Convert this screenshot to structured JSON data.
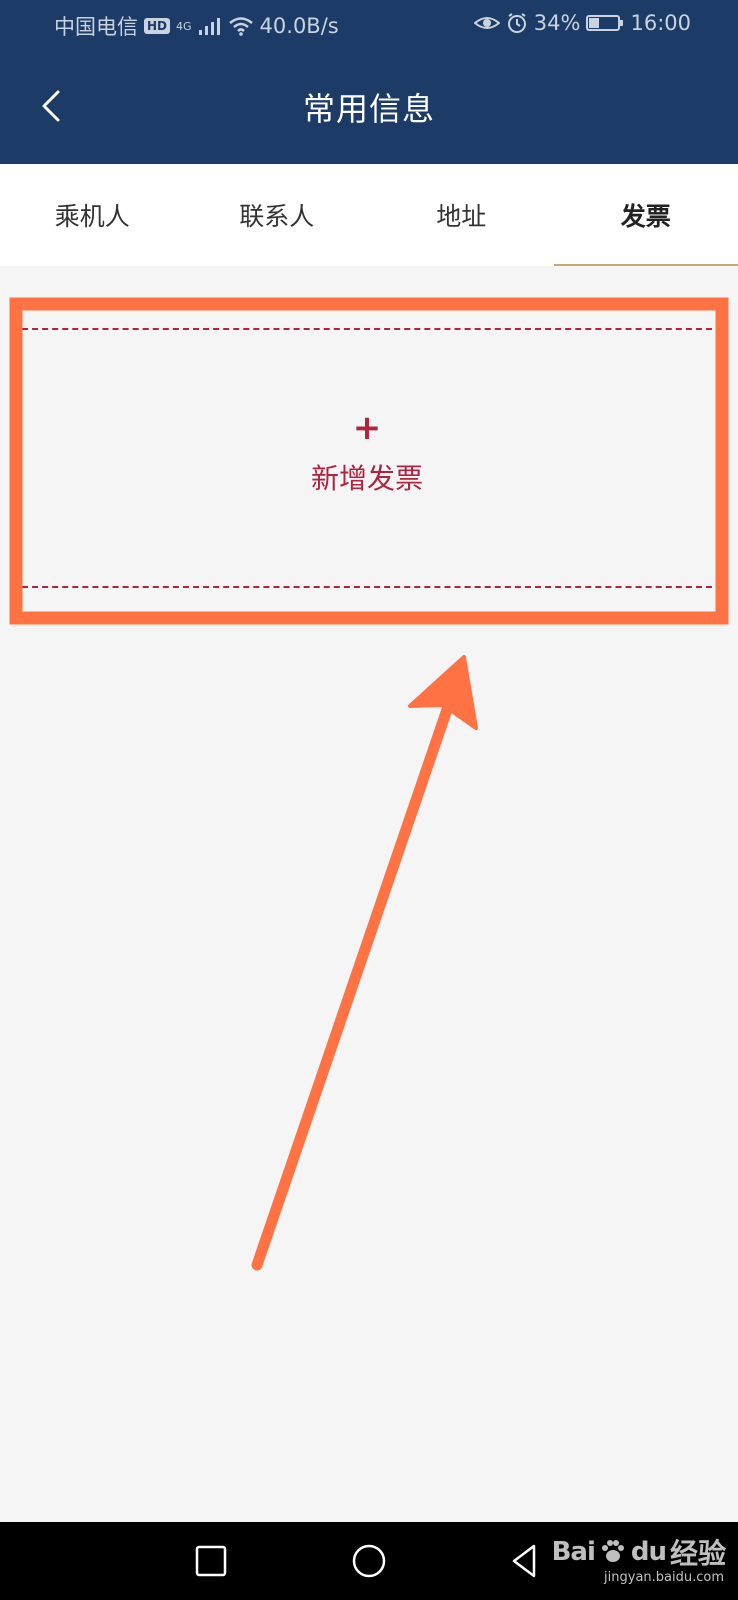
{
  "status_bar": {
    "carrier": "中国电信",
    "hd_badge": "HD",
    "network_type": "4G",
    "speed": "40.0B/s",
    "battery": "34%",
    "time": "16:00"
  },
  "header": {
    "title": "常用信息"
  },
  "tabs": [
    {
      "label": "乘机人",
      "active": false
    },
    {
      "label": "联系人",
      "active": false
    },
    {
      "label": "地址",
      "active": false
    },
    {
      "label": "发票",
      "active": true
    }
  ],
  "add_invoice": {
    "plus": "+",
    "label": "新增发票"
  },
  "watermark": {
    "brand": "Bai",
    "brand_suffix": "du",
    "sub": "经验",
    "url": "jingyan.baidu.com"
  },
  "colors": {
    "header_bg": "#1c3b66",
    "accent_red": "#b0243f",
    "tab_indicator": "#c5ac6f",
    "annotation_orange": "#ff7243"
  },
  "icons": {
    "back": "chevron-left-icon",
    "nav": [
      "square-icon",
      "circle-icon",
      "triangle-back-icon"
    ]
  }
}
